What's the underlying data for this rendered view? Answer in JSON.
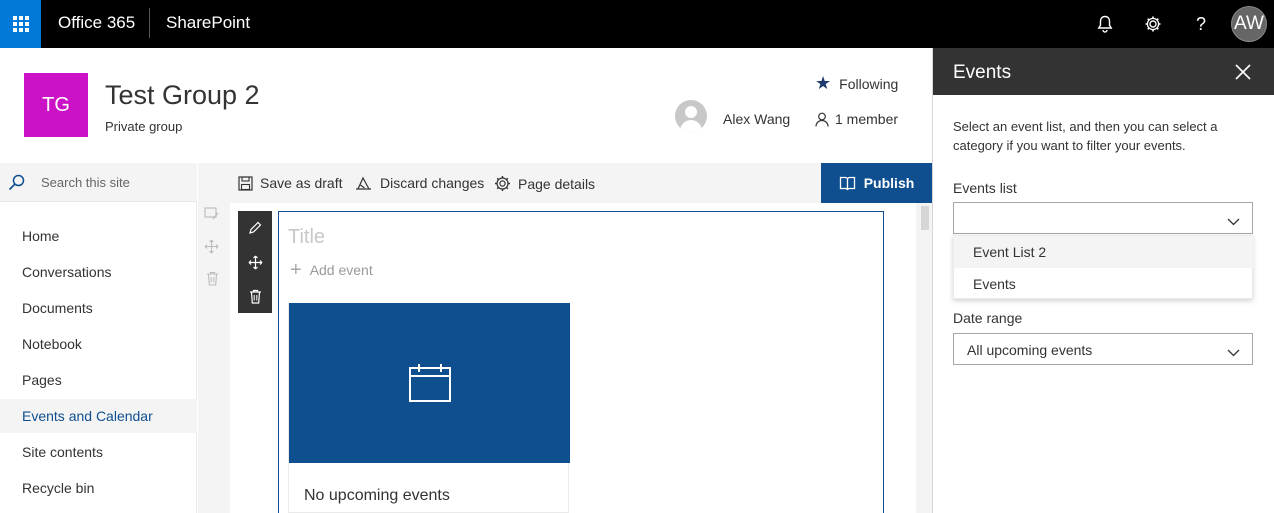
{
  "suite": {
    "app_name": "Office 365",
    "product": "SharePoint",
    "icons": [
      "app-launcher-icon",
      "bell-icon",
      "gear-icon",
      "help-icon"
    ],
    "help_glyph": "?",
    "user_initials": "AW",
    "accent": "#0078d7"
  },
  "site": {
    "logo_text": "TG",
    "logo_color": "#cc12c6",
    "title": "Test Group 2",
    "subtitle": "Private group",
    "following_label": "Following",
    "user_name": "Alex Wang",
    "member_label": "1 member"
  },
  "nav": {
    "search_placeholder": "Search this site",
    "items": [
      {
        "label": "Home"
      },
      {
        "label": "Conversations"
      },
      {
        "label": "Documents"
      },
      {
        "label": "Notebook"
      },
      {
        "label": "Pages"
      },
      {
        "label": "Events and Calendar",
        "active": true
      },
      {
        "label": "Site contents"
      },
      {
        "label": "Recycle bin"
      }
    ]
  },
  "commands": {
    "save_draft": "Save as draft",
    "discard": "Discard changes",
    "page_details": "Page details",
    "publish": "Publish",
    "publish_color": "#0f4f8f"
  },
  "webpart": {
    "title_placeholder": "Title",
    "add_event": "Add event",
    "empty_message": "No upcoming events"
  },
  "panel": {
    "title": "Events",
    "description": "Select an event list, and then you can select a category if you want to filter your events.",
    "events_list_label": "Events list",
    "events_list_value": "",
    "events_list_options": [
      "Event List 2",
      "Events"
    ],
    "date_range_label": "Date range",
    "date_range_value": "All upcoming events"
  }
}
